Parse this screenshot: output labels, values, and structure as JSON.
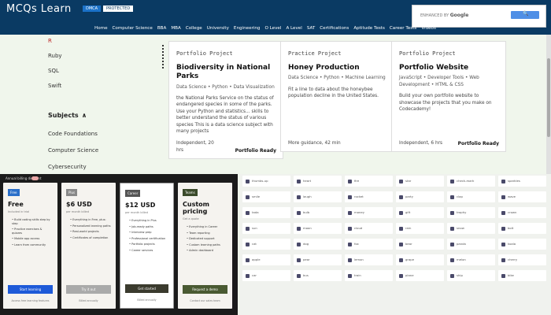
{
  "brand": "MCQs Learn",
  "dmca": "DMCA",
  "protected": "PROTECTED",
  "google": {
    "enhanced": "ENHANCED BY",
    "google": "Google",
    "search_label": "🔍"
  },
  "nav": [
    "Home",
    "Computer Science",
    "BBA",
    "MBA",
    "College",
    "University",
    "Engineering",
    "O Level",
    "A Level",
    "SAT",
    "Certifications",
    "Aptitude Tests",
    "Career Tests",
    "Videos"
  ],
  "left_items": [
    "R",
    "Ruby",
    "SQL",
    "Swift"
  ],
  "subjects_title": "Subjects",
  "subject_items": [
    "Code Foundations",
    "Computer Science",
    "Cybersecurity"
  ],
  "cards": [
    {
      "tag": "Portfolio Project",
      "title": "Biodiversity in National Parks",
      "meta": "Data Science • Python • Data Visualization",
      "desc": "the National Parks Service on the status of endangered species in some of the parks. Use your Python and statistics... skills to better understand the status of various species This is a data science subject with many projects",
      "foot": "Independent, 20 hrs",
      "badge": "Portfolio Ready"
    },
    {
      "tag": "Practice Project",
      "title": "Honey Production",
      "meta": "Data Science • Python • Machine Learning",
      "desc": "Fit a line to data about the honeybee population decline in the United States.",
      "foot": "More guidance, 42 min",
      "badge": ""
    },
    {
      "tag": "Portfolio Project",
      "title": "Portfolio Website",
      "meta": "JavaScript • Developer Tools • Web Development • HTML & CSS",
      "desc": "Build your own portfolio website to showcase the projects that you make on Codecademy!",
      "foot": "Independent, 6 hrs",
      "badge": "Portfolio Ready"
    }
  ],
  "pricing": {
    "toggle": "Annual billing discount",
    "plans": [
      {
        "label": "Free",
        "label_color": "#2a6fc9",
        "price": "Free",
        "sub": "Included in trial",
        "features": [
          "Build coding skills step by step",
          "Practice exercises & quizzes",
          "Mobile app access",
          "Learn from community"
        ],
        "button": "Start learning",
        "button_color": "#1e5ad8",
        "note": "Access free learning features"
      },
      {
        "label": "Plus",
        "label_color": "#888",
        "price": "$6 USD",
        "sub": "per month billed",
        "features": [
          "Everything in Free, plus:",
          "Personalized learning paths",
          "Real-world projects",
          "Certificates of completion"
        ],
        "button": "Try it out",
        "button_color": "#aaa",
        "note": "Billed annually"
      },
      {
        "label": "Career",
        "label_color": "#555",
        "price": "$12 USD",
        "sub": "per month billed",
        "features": [
          "Everything in Plus",
          "Job-ready paths",
          "Interview prep",
          "Professional certification",
          "Portfolio projects",
          "Career services"
        ],
        "button": "Get started",
        "button_color": "#3b3b2e",
        "note": "Billed annually"
      },
      {
        "label": "Teams",
        "label_color": "#3a4a2a",
        "price": "Custom pricing",
        "sub": "Get a quote",
        "features": [
          "Everything in Career",
          "Team reporting",
          "Dedicated support",
          "Custom learning paths",
          "Admin dashboard"
        ],
        "button": "Request a demo",
        "button_color": "#4a5a32",
        "note": "Contact our sales team"
      }
    ]
  },
  "emoji_grid": [
    "thumbs-up",
    "heart",
    "fire",
    "star",
    "check-mark",
    "sparkles",
    "smile",
    "laugh",
    "rocket",
    "party",
    "clap",
    "wave",
    "tada",
    "bulb",
    "money",
    "gift",
    "trophy",
    "crown",
    "sun",
    "moon",
    "cloud",
    "rain",
    "snow",
    "bolt",
    "cat",
    "dog",
    "fox",
    "bear",
    "panda",
    "koala",
    "apple",
    "pear",
    "lemon",
    "grape",
    "melon",
    "cherry",
    "car",
    "bus",
    "train",
    "plane",
    "ship",
    "bike"
  ]
}
